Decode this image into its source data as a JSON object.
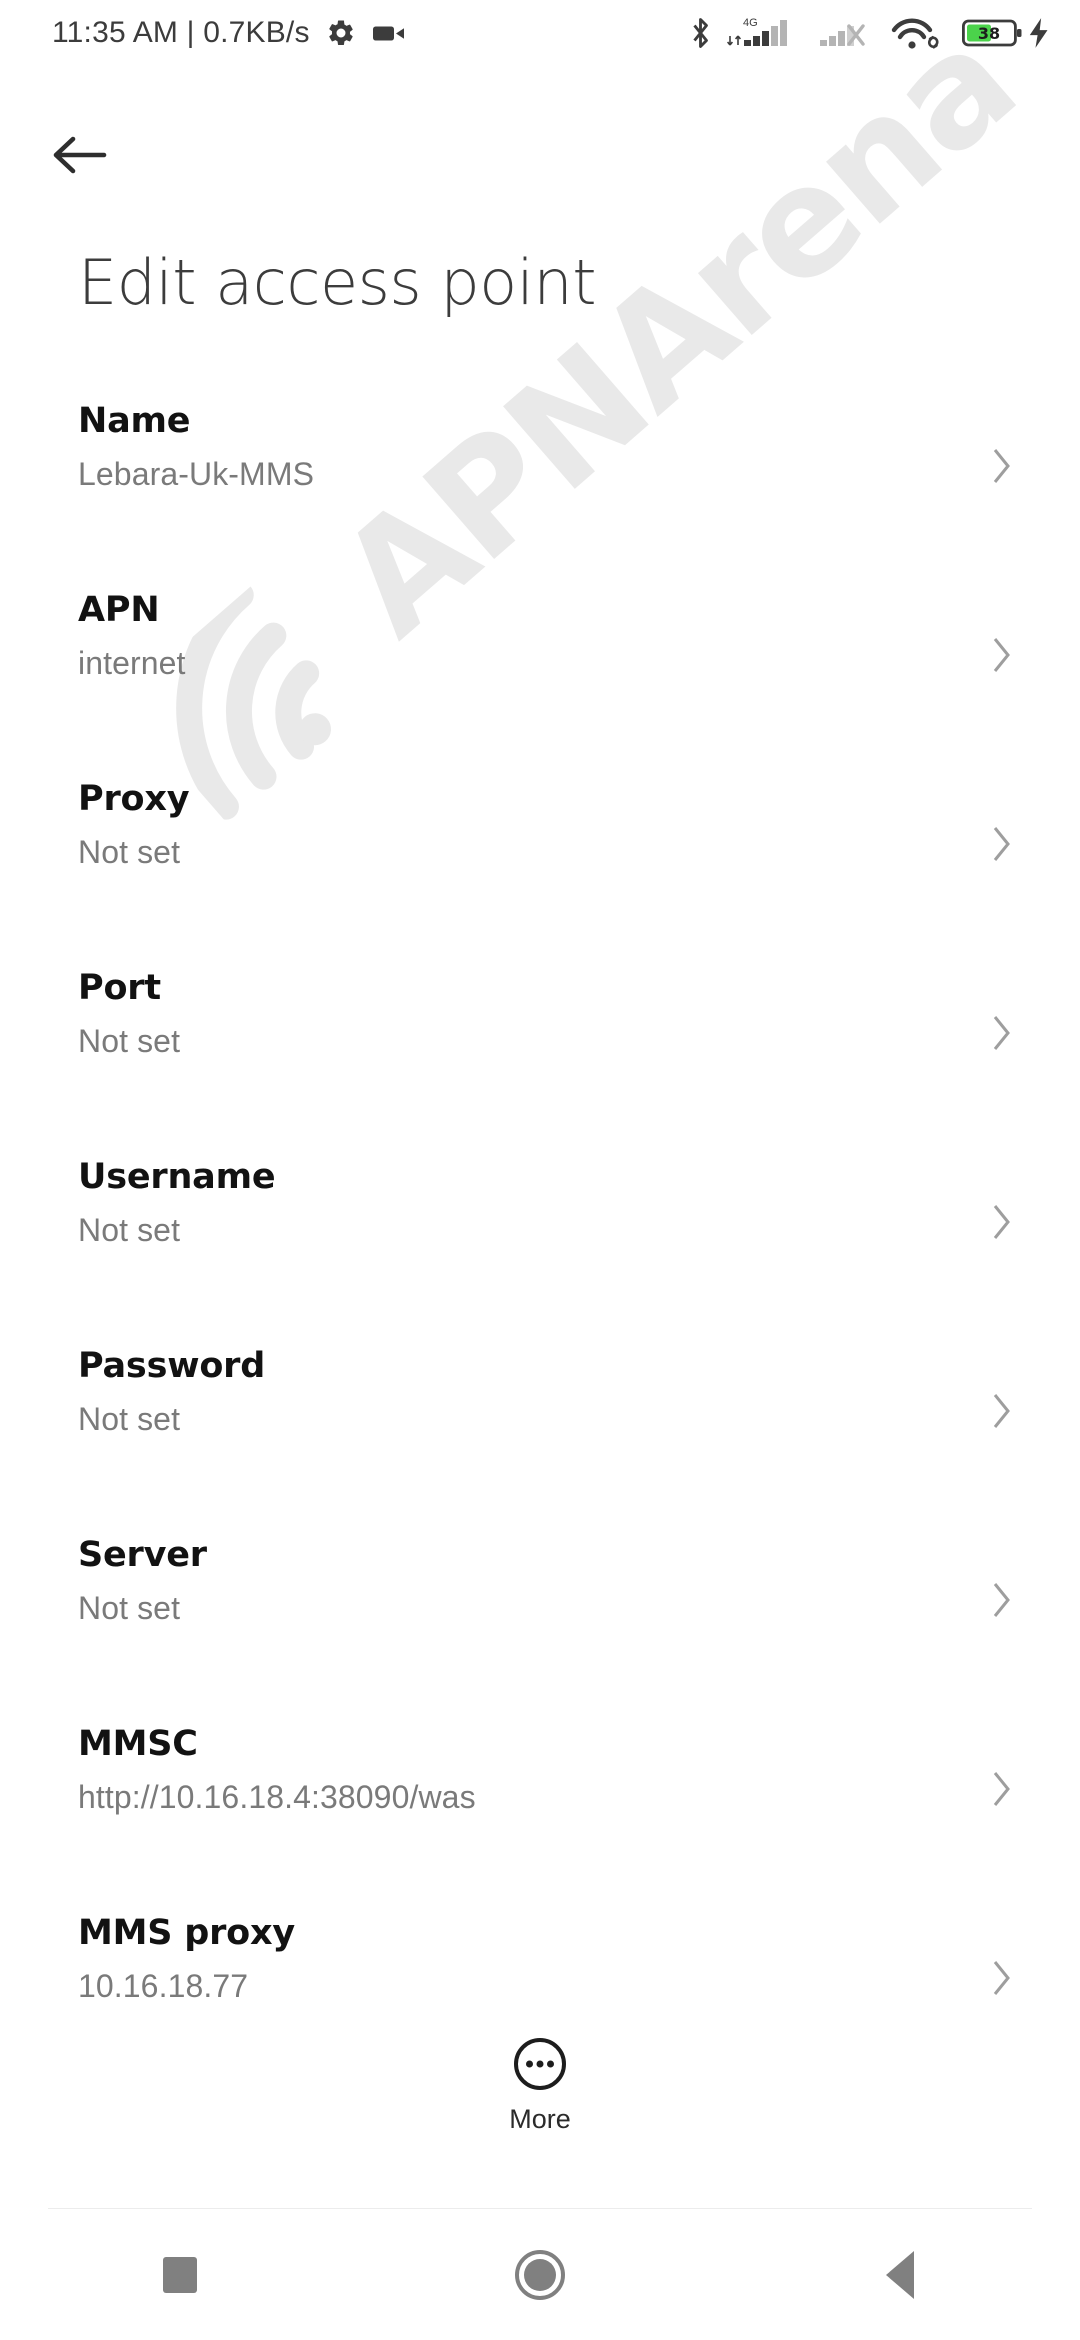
{
  "status_bar": {
    "clock": "11:35 AM | 0.7KB/s",
    "left_icons": [
      "gear-icon",
      "video-camera-icon"
    ],
    "right_icons": [
      "bluetooth-icon",
      "signal-4g-icon",
      "signal-sim2-no-service-icon",
      "wifi-icon",
      "battery-icon",
      "charging-bolt-icon"
    ],
    "network_type": "4G",
    "battery_percent": "38",
    "charging": true
  },
  "header": {
    "back_icon": "arrow-left-icon",
    "title": "Edit access point"
  },
  "settings": {
    "rows": [
      {
        "label": "Name",
        "value": "Lebara-Uk-MMS"
      },
      {
        "label": "APN",
        "value": "internet"
      },
      {
        "label": "Proxy",
        "value": "Not set"
      },
      {
        "label": "Port",
        "value": "Not set"
      },
      {
        "label": "Username",
        "value": "Not set"
      },
      {
        "label": "Password",
        "value": "Not set"
      },
      {
        "label": "Server",
        "value": "Not set"
      },
      {
        "label": "MMSC",
        "value": "http://10.16.18.4:38090/was"
      },
      {
        "label": "MMS proxy",
        "value": "10.16.18.77"
      }
    ]
  },
  "more_button": {
    "label": "More",
    "icon": "more-horizontal-circle-icon"
  },
  "nav_bar": {
    "recents_label": "recents-button",
    "home_label": "home-button",
    "back_label": "back-button"
  },
  "watermark": {
    "text": "APNArena",
    "icon": "wifi-arc-icon",
    "color": "#e9e9e9"
  },
  "colors": {
    "background": "#ffffff",
    "label_text": "#121212",
    "value_text": "#7a7a7a",
    "title_text": "#3c3c3c",
    "chevron": "#9e9e9e",
    "nav_icon": "#808080",
    "battery_green": "#4bd34b",
    "divider": "#ececec"
  }
}
